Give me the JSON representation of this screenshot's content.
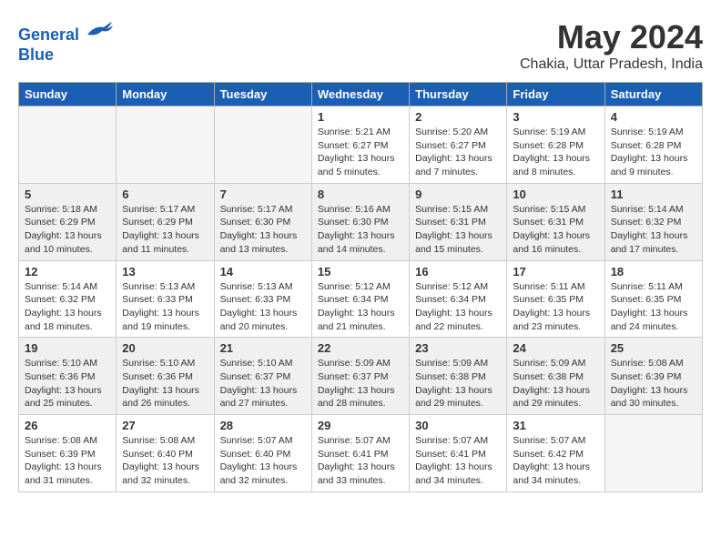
{
  "header": {
    "logo_line1": "General",
    "logo_line2": "Blue",
    "month_title": "May 2024",
    "location": "Chakia, Uttar Pradesh, India"
  },
  "days_of_week": [
    "Sunday",
    "Monday",
    "Tuesday",
    "Wednesday",
    "Thursday",
    "Friday",
    "Saturday"
  ],
  "weeks": [
    [
      {
        "num": "",
        "info": ""
      },
      {
        "num": "",
        "info": ""
      },
      {
        "num": "",
        "info": ""
      },
      {
        "num": "1",
        "info": "Sunrise: 5:21 AM\nSunset: 6:27 PM\nDaylight: 13 hours\nand 5 minutes."
      },
      {
        "num": "2",
        "info": "Sunrise: 5:20 AM\nSunset: 6:27 PM\nDaylight: 13 hours\nand 7 minutes."
      },
      {
        "num": "3",
        "info": "Sunrise: 5:19 AM\nSunset: 6:28 PM\nDaylight: 13 hours\nand 8 minutes."
      },
      {
        "num": "4",
        "info": "Sunrise: 5:19 AM\nSunset: 6:28 PM\nDaylight: 13 hours\nand 9 minutes."
      }
    ],
    [
      {
        "num": "5",
        "info": "Sunrise: 5:18 AM\nSunset: 6:29 PM\nDaylight: 13 hours\nand 10 minutes."
      },
      {
        "num": "6",
        "info": "Sunrise: 5:17 AM\nSunset: 6:29 PM\nDaylight: 13 hours\nand 11 minutes."
      },
      {
        "num": "7",
        "info": "Sunrise: 5:17 AM\nSunset: 6:30 PM\nDaylight: 13 hours\nand 13 minutes."
      },
      {
        "num": "8",
        "info": "Sunrise: 5:16 AM\nSunset: 6:30 PM\nDaylight: 13 hours\nand 14 minutes."
      },
      {
        "num": "9",
        "info": "Sunrise: 5:15 AM\nSunset: 6:31 PM\nDaylight: 13 hours\nand 15 minutes."
      },
      {
        "num": "10",
        "info": "Sunrise: 5:15 AM\nSunset: 6:31 PM\nDaylight: 13 hours\nand 16 minutes."
      },
      {
        "num": "11",
        "info": "Sunrise: 5:14 AM\nSunset: 6:32 PM\nDaylight: 13 hours\nand 17 minutes."
      }
    ],
    [
      {
        "num": "12",
        "info": "Sunrise: 5:14 AM\nSunset: 6:32 PM\nDaylight: 13 hours\nand 18 minutes."
      },
      {
        "num": "13",
        "info": "Sunrise: 5:13 AM\nSunset: 6:33 PM\nDaylight: 13 hours\nand 19 minutes."
      },
      {
        "num": "14",
        "info": "Sunrise: 5:13 AM\nSunset: 6:33 PM\nDaylight: 13 hours\nand 20 minutes."
      },
      {
        "num": "15",
        "info": "Sunrise: 5:12 AM\nSunset: 6:34 PM\nDaylight: 13 hours\nand 21 minutes."
      },
      {
        "num": "16",
        "info": "Sunrise: 5:12 AM\nSunset: 6:34 PM\nDaylight: 13 hours\nand 22 minutes."
      },
      {
        "num": "17",
        "info": "Sunrise: 5:11 AM\nSunset: 6:35 PM\nDaylight: 13 hours\nand 23 minutes."
      },
      {
        "num": "18",
        "info": "Sunrise: 5:11 AM\nSunset: 6:35 PM\nDaylight: 13 hours\nand 24 minutes."
      }
    ],
    [
      {
        "num": "19",
        "info": "Sunrise: 5:10 AM\nSunset: 6:36 PM\nDaylight: 13 hours\nand 25 minutes."
      },
      {
        "num": "20",
        "info": "Sunrise: 5:10 AM\nSunset: 6:36 PM\nDaylight: 13 hours\nand 26 minutes."
      },
      {
        "num": "21",
        "info": "Sunrise: 5:10 AM\nSunset: 6:37 PM\nDaylight: 13 hours\nand 27 minutes."
      },
      {
        "num": "22",
        "info": "Sunrise: 5:09 AM\nSunset: 6:37 PM\nDaylight: 13 hours\nand 28 minutes."
      },
      {
        "num": "23",
        "info": "Sunrise: 5:09 AM\nSunset: 6:38 PM\nDaylight: 13 hours\nand 29 minutes."
      },
      {
        "num": "24",
        "info": "Sunrise: 5:09 AM\nSunset: 6:38 PM\nDaylight: 13 hours\nand 29 minutes."
      },
      {
        "num": "25",
        "info": "Sunrise: 5:08 AM\nSunset: 6:39 PM\nDaylight: 13 hours\nand 30 minutes."
      }
    ],
    [
      {
        "num": "26",
        "info": "Sunrise: 5:08 AM\nSunset: 6:39 PM\nDaylight: 13 hours\nand 31 minutes."
      },
      {
        "num": "27",
        "info": "Sunrise: 5:08 AM\nSunset: 6:40 PM\nDaylight: 13 hours\nand 32 minutes."
      },
      {
        "num": "28",
        "info": "Sunrise: 5:07 AM\nSunset: 6:40 PM\nDaylight: 13 hours\nand 32 minutes."
      },
      {
        "num": "29",
        "info": "Sunrise: 5:07 AM\nSunset: 6:41 PM\nDaylight: 13 hours\nand 33 minutes."
      },
      {
        "num": "30",
        "info": "Sunrise: 5:07 AM\nSunset: 6:41 PM\nDaylight: 13 hours\nand 34 minutes."
      },
      {
        "num": "31",
        "info": "Sunrise: 5:07 AM\nSunset: 6:42 PM\nDaylight: 13 hours\nand 34 minutes."
      },
      {
        "num": "",
        "info": ""
      }
    ]
  ]
}
